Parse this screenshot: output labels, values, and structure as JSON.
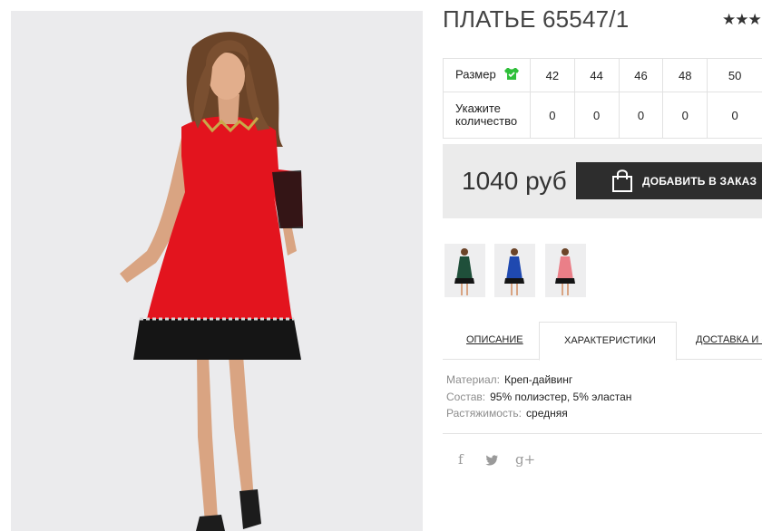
{
  "product": {
    "title": "ПЛАТЬЕ 65547/1",
    "rating_stars": "★★★"
  },
  "size_table": {
    "size_label": "Размер",
    "qty_label": "Укажите количество",
    "sizes": [
      "42",
      "44",
      "46",
      "48",
      "50"
    ],
    "quantities": [
      "0",
      "0",
      "0",
      "0",
      "0"
    ]
  },
  "purchase": {
    "price": "1040 руб",
    "add_button_label": "ДОБАВИТЬ В ЗАКАЗ"
  },
  "thumbnails": [
    {
      "color": "#1f4f3a",
      "name": "green-dress"
    },
    {
      "color": "#1f49b0",
      "name": "blue-dress"
    },
    {
      "color": "#ea7f88",
      "name": "pink-dress"
    }
  ],
  "tabs": [
    {
      "label": "ОПИСАНИЕ",
      "active": false
    },
    {
      "label": "ХАРАКТЕРИСТИКИ",
      "active": true
    },
    {
      "label": "ДОСТАВКА И С",
      "active": false
    }
  ],
  "characteristics": [
    {
      "key": "Материал:",
      "value": "Креп-дайвинг"
    },
    {
      "key": "Состав:",
      "value": "95% полиэстер, 5% эластан"
    },
    {
      "key": "Растяжимость:",
      "value": "средняя"
    }
  ],
  "social": {
    "facebook": "f",
    "twitter": "🐦",
    "gplus": "g+"
  },
  "colors": {
    "dress_red": "#e3141e",
    "accent_green": "#2fbf3a",
    "button_dark": "#2d2d2d"
  }
}
